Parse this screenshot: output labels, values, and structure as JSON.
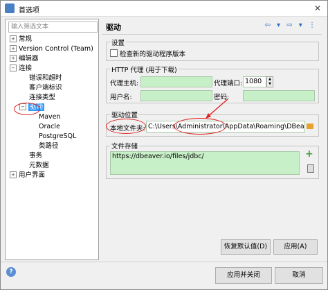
{
  "window": {
    "title": "首选项"
  },
  "left": {
    "filter_placeholder": "输入筛选文本",
    "tree": [
      {
        "label": "常规",
        "exp": "+",
        "indent": 0
      },
      {
        "label": "Version Control (Team)",
        "exp": "+",
        "indent": 0
      },
      {
        "label": "编辑器",
        "exp": "+",
        "indent": 0
      },
      {
        "label": "连接",
        "exp": "−",
        "indent": 0
      },
      {
        "label": "错误和超时",
        "exp": "",
        "indent": 1
      },
      {
        "label": "客户端标识",
        "exp": "",
        "indent": 1
      },
      {
        "label": "连接类型",
        "exp": "",
        "indent": 1
      },
      {
        "label": "驱动",
        "exp": "−",
        "indent": 1,
        "selected": true
      },
      {
        "label": "Maven",
        "exp": "",
        "indent": 2
      },
      {
        "label": "Oracle",
        "exp": "",
        "indent": 2
      },
      {
        "label": "PostgreSQL",
        "exp": "",
        "indent": 2
      },
      {
        "label": "类路径",
        "exp": "",
        "indent": 2
      },
      {
        "label": "事务",
        "exp": "",
        "indent": 1
      },
      {
        "label": "元数据",
        "exp": "",
        "indent": 1
      },
      {
        "label": "用户界面",
        "exp": "+",
        "indent": 0
      }
    ]
  },
  "right": {
    "title": "驱动",
    "settings": {
      "group": "设置",
      "check_label": "检查新的驱动程序版本"
    },
    "proxy": {
      "group": "HTTP 代理 (用于下载)",
      "host_label": "代理主机:",
      "port_label": "代理端口:",
      "port_value": "1080",
      "user_label": "用户名:",
      "password_label": "密码:"
    },
    "location": {
      "group": "驱动位置",
      "folder_label": "本地文件夹:",
      "folder_value": "C:\\Users\\Administrator\\AppData\\Roaming\\DBeaver"
    },
    "repo": {
      "group": "文件存储",
      "items": [
        "https://dbeaver.io/files/jdbc/"
      ]
    },
    "restore_label": "恢复默认值(D)",
    "apply_label": "应用(A)"
  },
  "footer": {
    "apply_close_label": "应用并关闭",
    "cancel_label": "取消"
  }
}
